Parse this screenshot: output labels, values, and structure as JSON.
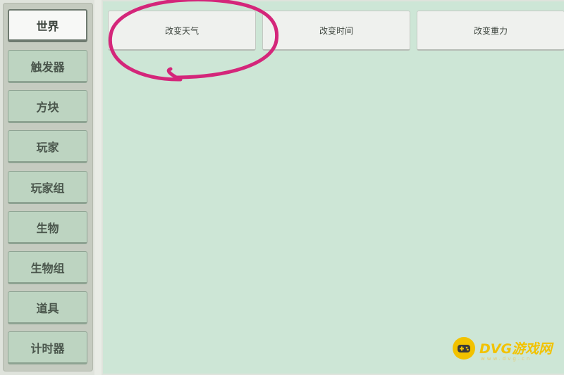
{
  "sidebar": {
    "items": [
      {
        "label": "世界",
        "active": true
      },
      {
        "label": "触发器"
      },
      {
        "label": "方块"
      },
      {
        "label": "玩家"
      },
      {
        "label": "玩家组"
      },
      {
        "label": "生物"
      },
      {
        "label": "生物组"
      },
      {
        "label": "道具"
      },
      {
        "label": "计时器"
      }
    ]
  },
  "actions": [
    {
      "label": "改变天气"
    },
    {
      "label": "改变时间"
    },
    {
      "label": "改变重力"
    }
  ],
  "annotation": {
    "color": "#d4267a",
    "target": "改变天气"
  },
  "watermark": {
    "text": "DVG游戏网",
    "sub": "www.dvg.cn",
    "color": "#f2c200"
  }
}
